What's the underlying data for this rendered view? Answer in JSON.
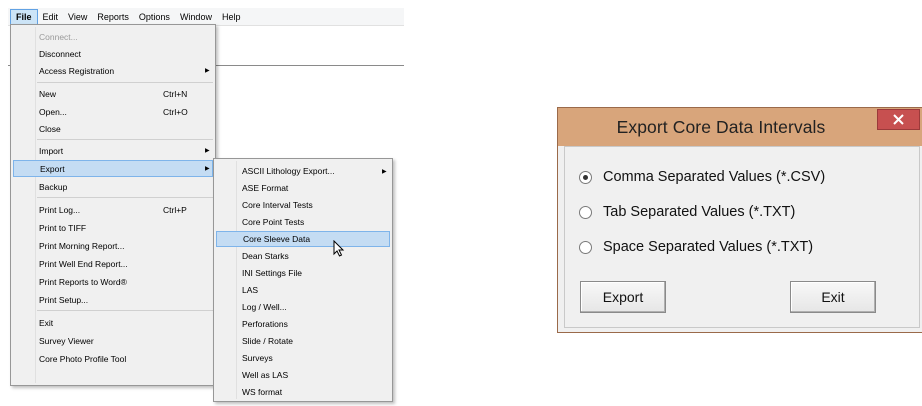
{
  "menubar": {
    "items": [
      "File",
      "Edit",
      "View",
      "Reports",
      "Options",
      "Window",
      "Help"
    ]
  },
  "file_menu": {
    "items": [
      {
        "label": "Connect...",
        "disabled": true
      },
      {
        "label": "Disconnect"
      },
      {
        "label": "Access Registration",
        "submenu": true
      },
      {
        "label": "New",
        "shortcut": "Ctrl+N"
      },
      {
        "label": "Open...",
        "shortcut": "Ctrl+O"
      },
      {
        "label": "Close"
      },
      {
        "label": "Import",
        "submenu": true
      },
      {
        "label": "Export",
        "submenu": true,
        "highlighted": true
      },
      {
        "label": "Backup"
      },
      {
        "label": "Print Log...",
        "shortcut": "Ctrl+P"
      },
      {
        "label": "Print to TIFF"
      },
      {
        "label": "Print Morning Report..."
      },
      {
        "label": "Print Well End Report..."
      },
      {
        "label": "Print Reports to Word®"
      },
      {
        "label": "Print Setup..."
      },
      {
        "label": "Exit"
      },
      {
        "label": "Survey Viewer"
      },
      {
        "label": "Core Photo Profile Tool"
      }
    ]
  },
  "export_menu": {
    "items": [
      {
        "label": "ASCII Lithology Export...",
        "submenu": true
      },
      {
        "label": "ASE Format"
      },
      {
        "label": "Core Interval Tests"
      },
      {
        "label": "Core Point Tests"
      },
      {
        "label": "Core Sleeve Data",
        "highlighted": true
      },
      {
        "label": "Dean Starks"
      },
      {
        "label": "INI Settings File"
      },
      {
        "label": "LAS"
      },
      {
        "label": "Log / Well..."
      },
      {
        "label": "Perforations"
      },
      {
        "label": "Slide / Rotate"
      },
      {
        "label": "Surveys"
      },
      {
        "label": "Well as LAS"
      },
      {
        "label": "WS format"
      }
    ]
  },
  "dialog": {
    "title": "Export Core Data Intervals",
    "close_glyph": "✕",
    "options": [
      {
        "label": "Comma Separated Values (*.CSV)",
        "checked": true
      },
      {
        "label": "Tab Separated Values (*.TXT)",
        "checked": false
      },
      {
        "label": "Space Separated Values (*.TXT)",
        "checked": false
      }
    ],
    "export_label": "Export",
    "exit_label": "Exit"
  },
  "colors": {
    "titlebar": "#d8a57b",
    "close_button": "#c75050",
    "menu_highlight": "#c4dcf3"
  }
}
